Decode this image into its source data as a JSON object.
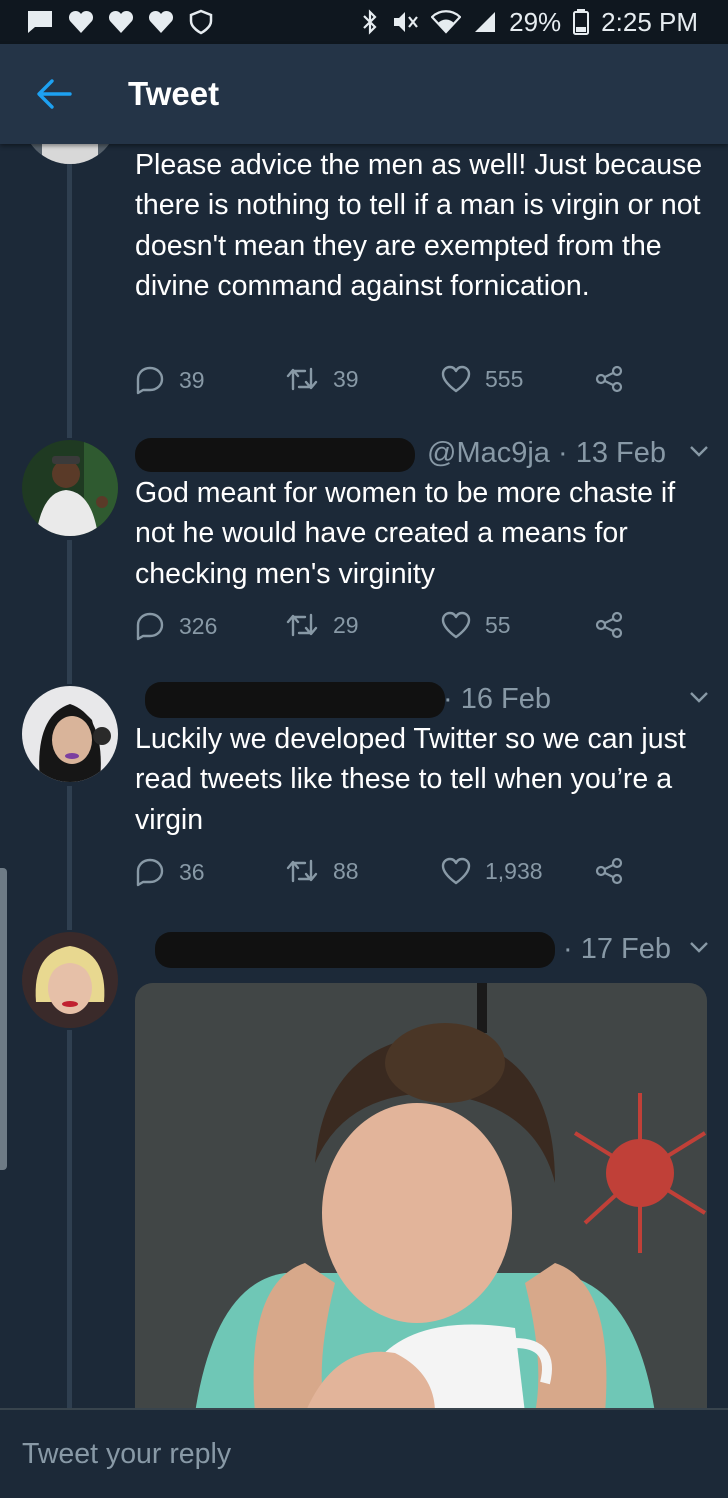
{
  "status": {
    "battery": "29%",
    "time": "2:25 PM"
  },
  "appbar": {
    "title": "Tweet"
  },
  "tweets": [
    {
      "text": "Please advice the men as well! Just because there is nothing to tell if a man is virgin or not doesn't mean they are exempted from the divine command against fornication.",
      "replies": "39",
      "retweets": "39",
      "likes": "555"
    },
    {
      "handle_date": "@Mac9ja · 13 Feb",
      "text": "God meant for women to be more chaste if not he would have created a means for checking men's virginity",
      "replies": "326",
      "retweets": "29",
      "likes": "55"
    },
    {
      "handle_date": "· 16 Feb",
      "text": "Luckily we developed Twitter so we can just read tweets like these to tell when you’re a virgin",
      "replies": "36",
      "retweets": "88",
      "likes": "1,938"
    },
    {
      "handle_date": "· 17 Feb"
    }
  ],
  "reply": {
    "placeholder": "Tweet your reply"
  },
  "colors": {
    "background": "#1c2938",
    "appbar": "#243447",
    "accent": "#1da1f2",
    "muted": "#8899a6"
  }
}
